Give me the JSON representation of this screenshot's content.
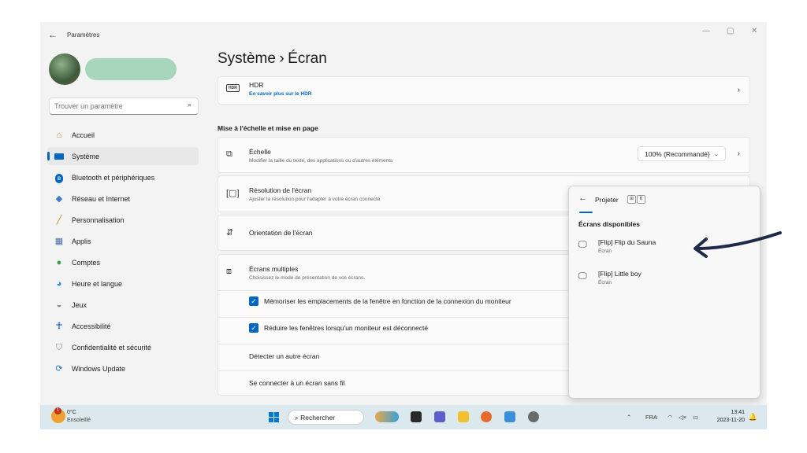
{
  "window": {
    "title": "Paramètres",
    "controls": {
      "minimize": "—",
      "maximize": "▢",
      "close": "✕"
    }
  },
  "sidebar": {
    "search_placeholder": "Trouver un paramètre",
    "items": [
      {
        "label": "Accueil",
        "icon": "home-icon",
        "color": "#d8862c"
      },
      {
        "label": "Système",
        "icon": "display-icon",
        "color": "#0067c0",
        "active": true
      },
      {
        "label": "Bluetooth et périphériques",
        "icon": "bluetooth-icon",
        "color": "#0067c0"
      },
      {
        "label": "Réseau et Internet",
        "icon": "wifi-icon",
        "color": "#3a7bd5"
      },
      {
        "label": "Personnalisation",
        "icon": "brush-icon",
        "color": "#d8862c"
      },
      {
        "label": "Applis",
        "icon": "apps-icon",
        "color": "#4a6fa5"
      },
      {
        "label": "Comptes",
        "icon": "person-icon",
        "color": "#2ea44f"
      },
      {
        "label": "Heure et langue",
        "icon": "globe-clock-icon",
        "color": "#2a8bd8"
      },
      {
        "label": "Jeux",
        "icon": "gamepad-icon",
        "color": "#888888"
      },
      {
        "label": "Accessibilité",
        "icon": "accessibility-icon",
        "color": "#1f6fc8"
      },
      {
        "label": "Confidentialité et sécurité",
        "icon": "shield-icon",
        "color": "#8a8a8a"
      },
      {
        "label": "Windows Update",
        "icon": "update-icon",
        "color": "#1f6fc8"
      }
    ]
  },
  "header": {
    "parent": "Système",
    "separator": "›",
    "current": "Écran"
  },
  "hdr": {
    "icon_text": "HDR",
    "title": "HDR",
    "link": "En savoir plus sur le HDR"
  },
  "section_title": "Mise à l'échelle et mise en page",
  "scale": {
    "title": "Échelle",
    "subtitle": "Modifier la taille du texte, des applications ou d'autres éléments",
    "value": "100% (Recommandé)"
  },
  "resolution": {
    "title": "Résolution de l'écran",
    "subtitle": "Ajuster la résolution pour l'adapter à  votre  écran connecté"
  },
  "orientation": {
    "title": "Orientation de l'écran"
  },
  "multiple": {
    "title": "Écrans multiples",
    "subtitle": "Choisissez le mode de présentation de vos écrans."
  },
  "remember": {
    "label": "Mémoriser les emplacements de la fenêtre en fonction de la connexion du moniteur",
    "checked": true
  },
  "minimize": {
    "label": "Réduire les fenêtres lorsqu'un moniteur est déconnecté",
    "checked": true
  },
  "detect": {
    "label": "Détecter un autre écran"
  },
  "wireless": {
    "label": "Se connecter à un écran sans fil"
  },
  "project": {
    "title": "Projeter",
    "key1": "⊞",
    "key2": "K",
    "section": "Écrans disponibles",
    "screens": [
      {
        "name": "[Flip] Flip du Sauna",
        "type": "Écran"
      },
      {
        "name": "[Flip] Little boy",
        "type": "Écran"
      }
    ]
  },
  "taskbar": {
    "weather_badge": "1",
    "temperature": "0°C",
    "condition": "Ensoleillé",
    "search": "Rechercher",
    "language": "FRA",
    "time": "13:41",
    "date": "2023-11-20"
  },
  "colors": {
    "accent": "#0067c0",
    "annotation_arrow": "#1e2a4a"
  }
}
